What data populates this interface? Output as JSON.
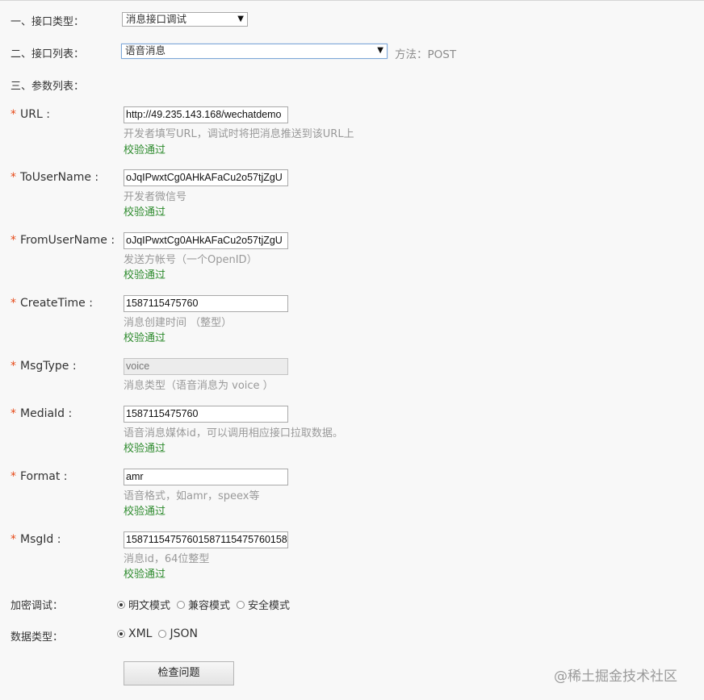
{
  "section1": {
    "label": "一、接口类型：",
    "value": "消息接口调试"
  },
  "section2": {
    "label": "二、接口列表：",
    "value": "语音消息",
    "method": "方法：POST"
  },
  "section3": {
    "label": "三、参数列表："
  },
  "params": [
    {
      "label": "URL :",
      "value": "http://49.235.143.168/wechatdemo",
      "hint": "开发者填写URL，调试时将把消息推送到该URL上",
      "status": "校验通过"
    },
    {
      "label": "ToUserName :",
      "value": "oJqIPwxtCg0AHkAFaCu2o57tjZgU",
      "hint": "开发者微信号",
      "status": "校验通过"
    },
    {
      "label": "FromUserName :",
      "value": "oJqIPwxtCg0AHkAFaCu2o57tjZgU",
      "hint": "发送方帐号（一个OpenID）",
      "status": "校验通过"
    },
    {
      "label": "CreateTime :",
      "value": "1587115475760",
      "hint": "消息创建时间 （整型）",
      "status": "校验通过"
    },
    {
      "label": "MsgType :",
      "value": "voice",
      "hint": "消息类型（语音消息为 voice ）",
      "status": ""
    },
    {
      "label": "MediaId :",
      "value": "1587115475760",
      "hint": "语音消息媒体id，可以调用相应接口拉取数据。",
      "status": "校验通过"
    },
    {
      "label": "Format :",
      "value": "amr",
      "hint": "语音格式，如amr，speex等",
      "status": "校验通过"
    },
    {
      "label": "MsgId :",
      "value": "15871154757601587115475760158",
      "hint": "消息id，64位整型",
      "status": "校验通过"
    }
  ],
  "encrypt": {
    "label": "加密调试：",
    "options": [
      "明文模式",
      "兼容模式",
      "安全模式"
    ],
    "selected": "明文模式"
  },
  "datatype": {
    "label": "数据类型：",
    "options": [
      "XML",
      "JSON"
    ],
    "selected": "XML"
  },
  "button": "检查问题",
  "watermark": "@稀土掘金技术社区",
  "colors": {
    "required": "#e64a19",
    "ok": "#2c8a2c",
    "hint": "#999999"
  }
}
